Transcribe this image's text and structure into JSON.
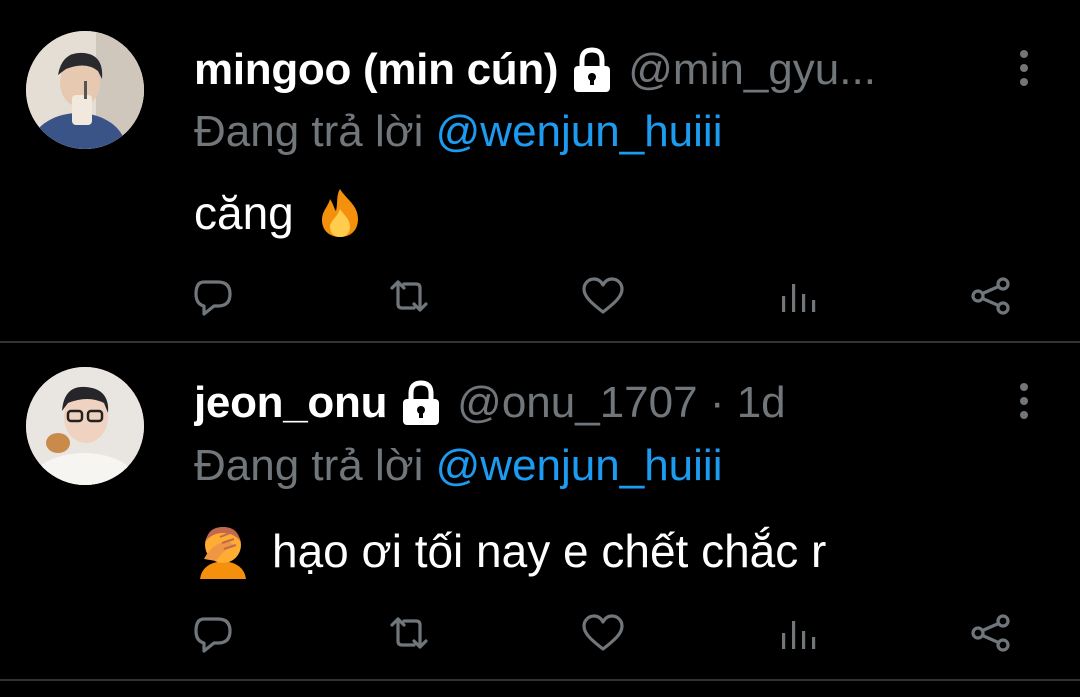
{
  "tweets": [
    {
      "display_name": "mingoo (min cún)",
      "handle": "@min_gyu...",
      "replying_prefix": "Đang trả lời",
      "replying_to": "@wenjun_huiii",
      "text": "căng",
      "emoji": "fire-icon",
      "protected_icon": "lock-icon"
    },
    {
      "display_name": "jeon_onu",
      "handle": "@onu_1707 · 1d",
      "replying_prefix": "Đang trả lời",
      "replying_to": "@wenjun_huiii",
      "text": "hạo ơi tối nay e chết chắc r",
      "emoji": "facepalm-icon",
      "protected_icon": "lock-icon"
    }
  ],
  "actions": [
    "reply-icon",
    "retweet-icon",
    "like-icon",
    "stats-icon",
    "share-icon"
  ],
  "colors": {
    "background": "#000000",
    "text": "#ffffff",
    "muted": "#71767b",
    "accent": "#1d9bf0",
    "divider": "#2f3336"
  }
}
